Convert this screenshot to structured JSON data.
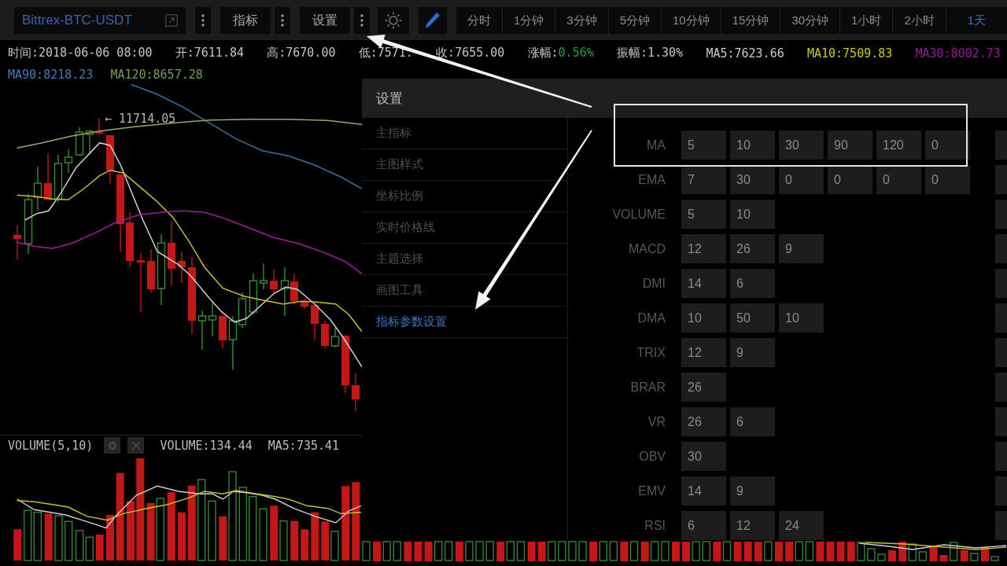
{
  "toolbar": {
    "symbol": "Bittrex-BTC-USDT",
    "buttons": [
      "指标",
      "设置"
    ],
    "timeframes": [
      {
        "label": "分时",
        "selected": false
      },
      {
        "label": "1分钟",
        "selected": false
      },
      {
        "label": "3分钟",
        "selected": false
      },
      {
        "label": "5分钟",
        "selected": false
      },
      {
        "label": "10分钟",
        "selected": false
      },
      {
        "label": "15分钟",
        "selected": false
      },
      {
        "label": "30分钟",
        "selected": false
      },
      {
        "label": "1小时",
        "selected": false
      },
      {
        "label": "2小时",
        "selected": false
      },
      {
        "label": "1天",
        "selected": true
      }
    ]
  },
  "quote_bar": {
    "row_1": [
      {
        "kind": "quote",
        "label": "时间:",
        "value": "2018-06-06 08:00"
      },
      {
        "kind": "quote",
        "label": "开:",
        "value": "7611.84"
      },
      {
        "kind": "quote",
        "label": "高:",
        "value": "7670.00"
      },
      {
        "kind": "quote",
        "label": "低:",
        "value": "7571."
      },
      {
        "kind": "quote",
        "label": "收:",
        "value": "7655.00"
      },
      {
        "kind": "quote",
        "label": "涨幅:",
        "value": "0.56%",
        "color": "#1d9e3e"
      },
      {
        "kind": "quote",
        "label": "振幅:",
        "value": "1.30%"
      },
      {
        "kind": "ma",
        "label": "MA5:",
        "value": "7623.66",
        "color": "#c8c8c8"
      },
      {
        "kind": "ma",
        "label": "MA10:",
        "value": "7509.83",
        "color": "#c9c91e"
      },
      {
        "kind": "ma",
        "label": "MA30:",
        "value": "8002.73",
        "color": "#8e1e8e"
      }
    ],
    "row_2": [
      {
        "kind": "ma",
        "label": "MA90:",
        "value": "8218.23",
        "color": "#3f7cba"
      },
      {
        "kind": "ma",
        "label": "MA120:",
        "value": "8657.28",
        "color": "#6f9e52"
      }
    ]
  },
  "main_chart": {
    "peak_label": "← 11714.05"
  },
  "volume_pane": {
    "title": "VOLUME(5,10)",
    "readings": [
      "VOLUME:134.44",
      "MA5:735.41"
    ]
  },
  "settings_dialog": {
    "title": "设置",
    "menu": [
      {
        "label": "主指标",
        "selected": false
      },
      {
        "label": "主图样式",
        "selected": false
      },
      {
        "label": "坐标比例",
        "selected": false
      },
      {
        "label": "实时价格线",
        "selected": false
      },
      {
        "label": "主题选择",
        "selected": false
      },
      {
        "label": "画图工具",
        "selected": false
      },
      {
        "label": "指标参数设置",
        "selected": true
      }
    ],
    "params": [
      {
        "name": "MA",
        "values": [
          "5",
          "10",
          "30",
          "90",
          "120",
          "0"
        ]
      },
      {
        "name": "EMA",
        "values": [
          "7",
          "30",
          "0",
          "0",
          "0",
          "0"
        ]
      },
      {
        "name": "VOLUME",
        "values": [
          "5",
          "10"
        ]
      },
      {
        "name": "MACD",
        "values": [
          "12",
          "26",
          "9"
        ]
      },
      {
        "name": "DMI",
        "values": [
          "14",
          "6"
        ]
      },
      {
        "name": "DMA",
        "values": [
          "10",
          "50",
          "10"
        ]
      },
      {
        "name": "TRIX",
        "values": [
          "12",
          "9"
        ]
      },
      {
        "name": "BRAR",
        "values": [
          "26"
        ]
      },
      {
        "name": "VR",
        "values": [
          "26",
          "6"
        ]
      },
      {
        "name": "OBV",
        "values": [
          "30"
        ]
      },
      {
        "name": "EMV",
        "values": [
          "14",
          "9"
        ]
      },
      {
        "name": "RSI",
        "values": [
          "6",
          "12",
          "24"
        ]
      }
    ]
  }
}
